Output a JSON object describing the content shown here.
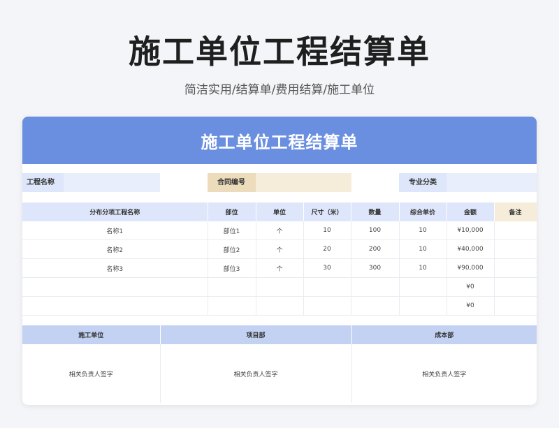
{
  "page": {
    "title": "施工单位工程结算单",
    "subtitle": "简洁实用/结算单/费用结算/施工单位"
  },
  "card": {
    "header": "施工单位工程结算单"
  },
  "info": {
    "project_name_label": "工程名称",
    "project_name_value": "",
    "contract_no_label": "合同编号",
    "contract_no_value": "",
    "specialty_label": "专业分类",
    "specialty_value": ""
  },
  "items_table": {
    "headers": [
      "分布分项工程名称",
      "部位",
      "单位",
      "尺寸（米）",
      "数量",
      "综合单价",
      "金额",
      "备注"
    ],
    "rows": [
      [
        "名称1",
        "部位1",
        "个",
        "10",
        "100",
        "10",
        "¥10,000",
        ""
      ],
      [
        "名称2",
        "部位2",
        "个",
        "20",
        "200",
        "10",
        "¥40,000",
        ""
      ],
      [
        "名称3",
        "部位3",
        "个",
        "30",
        "300",
        "10",
        "¥90,000",
        ""
      ],
      [
        "",
        "",
        "",
        "",
        "",
        "",
        "¥0",
        ""
      ],
      [
        "",
        "",
        "",
        "",
        "",
        "",
        "¥0",
        ""
      ]
    ]
  },
  "sign_table": {
    "headers": [
      "施工单位",
      "项目部",
      "成本部"
    ],
    "cells": [
      "相关负责人签字",
      "相关负责人签字",
      "相关负责人签字"
    ]
  },
  "colors": {
    "header_blue": "#6a8fe0",
    "label_blue": "#dde6fa",
    "label_beige": "#f6ecda",
    "sign_header_blue": "#c3d2f3"
  }
}
